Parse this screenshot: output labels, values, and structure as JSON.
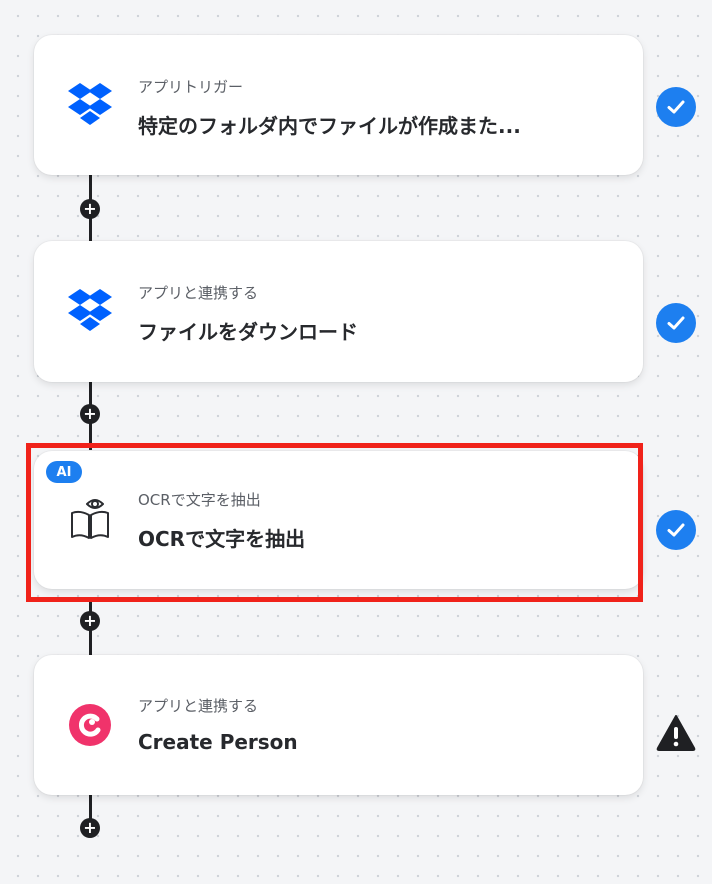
{
  "flow": {
    "steps": [
      {
        "subtitle": "アプリトリガー",
        "title": "特定のフォルダ内でファイルが作成また...",
        "app_icon": "dropbox-icon",
        "status": "complete"
      },
      {
        "subtitle": "アプリと連携する",
        "title": "ファイルをダウンロード",
        "app_icon": "dropbox-icon",
        "status": "complete"
      },
      {
        "subtitle": "OCRで文字を抽出",
        "title": "OCRで文字を抽出",
        "app_icon": "ocr-book-eye-icon",
        "badge": "AI",
        "status": "complete",
        "highlighted": true
      },
      {
        "subtitle": "アプリと連携する",
        "title": "Create Person",
        "app_icon": "capsule-crm-icon",
        "status": "warning"
      }
    ],
    "add_step_label": "+"
  },
  "colors": {
    "accent": "#1d7ff0",
    "highlight_border": "#f0221a",
    "dropbox": "#0061fe",
    "capsule": "#f0336b",
    "warning": "#1f2023"
  }
}
